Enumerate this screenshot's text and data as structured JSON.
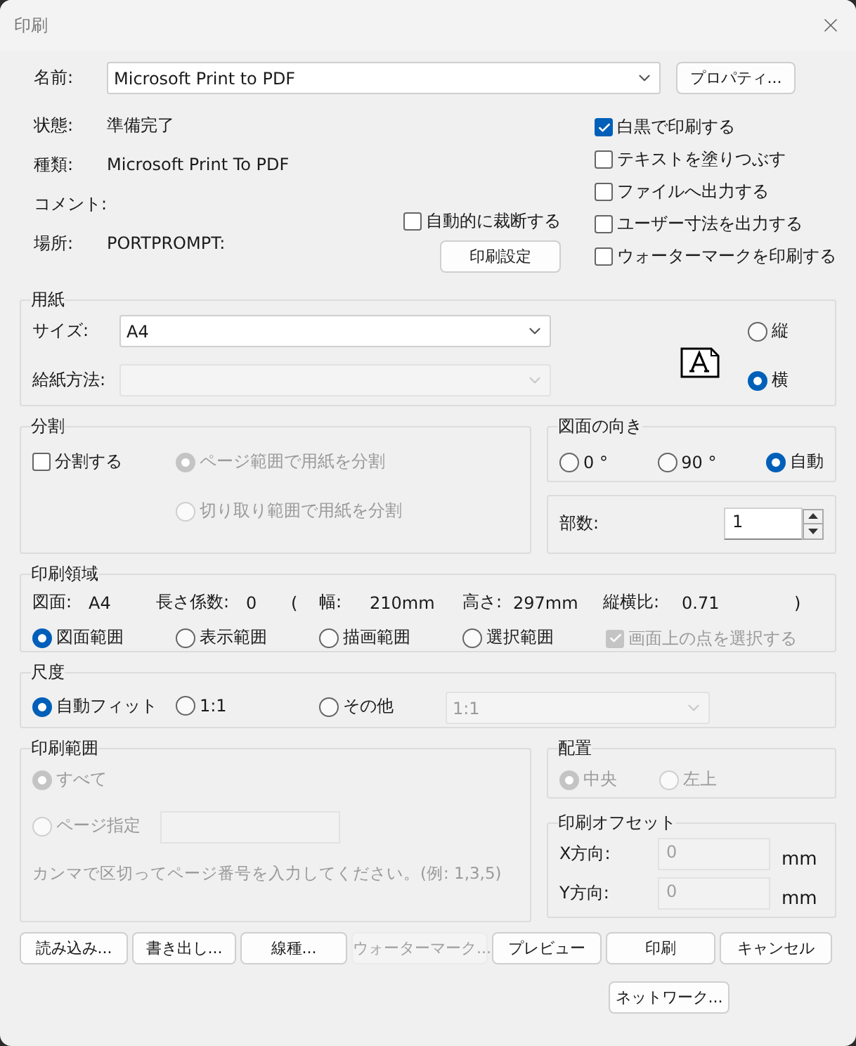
{
  "window": {
    "title": "印刷"
  },
  "printer": {
    "name_label": "名前:",
    "name": "Microsoft Print to PDF",
    "properties_button": "プロパティ...",
    "fields": [
      {
        "label": "状態:",
        "value": "準備完了"
      },
      {
        "label": "種類:",
        "value": "Microsoft Print To PDF"
      },
      {
        "label": "コメント:"
      },
      {
        "label": "場所:",
        "value": "PORTPROMPT:"
      }
    ],
    "auto_cut": {
      "label": "自動的に裁断する",
      "checked": false
    },
    "print_settings_button": "印刷設定",
    "options": [
      {
        "label": "白黒で印刷する",
        "checked": true
      },
      {
        "label": "テキストを塗りつぶす",
        "checked": false
      },
      {
        "label": "ファイルへ出力する",
        "checked": false
      },
      {
        "label": "ユーザー寸法を出力する",
        "checked": false
      },
      {
        "label": "ウォーターマークを印刷する",
        "checked": false
      }
    ]
  },
  "paper": {
    "title": "用紙",
    "size_label": "サイズ:",
    "size": "A4",
    "source_label": "給紙方法:",
    "source_disabled": true,
    "orientations": [
      {
        "label": "縦",
        "selected": false
      },
      {
        "label": "横",
        "selected": true
      }
    ]
  },
  "split": {
    "title": "分割",
    "enable": {
      "label": "分割する",
      "checked": false
    },
    "modes": [
      {
        "label": "ページ範囲で用紙を分割",
        "selected": true,
        "disabled": true
      },
      {
        "label": "切り取り範囲で用紙を分割",
        "selected": false,
        "disabled": true
      }
    ]
  },
  "rotation": {
    "title": "図面の向き",
    "options": [
      {
        "label": "0 °",
        "selected": false
      },
      {
        "label": "90 °",
        "selected": false
      },
      {
        "label": "自動",
        "selected": true
      }
    ]
  },
  "copies": {
    "label": "部数:",
    "value": "1"
  },
  "print_area": {
    "title": "印刷領域",
    "info": [
      {
        "label": "図面:",
        "value": "A4"
      },
      {
        "label": "長さ係数:",
        "value": "0"
      },
      {
        "label": "幅:",
        "value": "210mm"
      },
      {
        "label": "高さ:",
        "value": "297mm"
      },
      {
        "label": "縦横比:",
        "value": "0.71"
      }
    ],
    "open_paren": "(",
    "close_paren": ")",
    "options": [
      {
        "label": "図面範囲",
        "selected": true
      },
      {
        "label": "表示範囲",
        "selected": false
      },
      {
        "label": "描画範囲",
        "selected": false
      },
      {
        "label": "選択範囲",
        "selected": false
      }
    ],
    "pick_points": {
      "label": "画面上の点を選択する",
      "checked": true,
      "disabled": true
    }
  },
  "scale": {
    "title": "尺度",
    "options": [
      {
        "label": "自動フィット",
        "selected": true
      },
      {
        "label": "1:1",
        "selected": false
      },
      {
        "label": "その他",
        "selected": false
      }
    ],
    "custom": {
      "value": "1:1",
      "disabled": true
    }
  },
  "print_range": {
    "title": "印刷範囲",
    "options": [
      {
        "label": "すべて",
        "selected": true,
        "disabled": true
      },
      {
        "label": "ページ指定",
        "selected": false,
        "disabled": true
      }
    ],
    "pages_disabled": true,
    "hint": "カンマで区切ってページ番号を入力してください。(例: 1,3,5)"
  },
  "placement": {
    "title": "配置",
    "options": [
      {
        "label": "中央",
        "selected": true,
        "disabled": true
      },
      {
        "label": "左上",
        "selected": false,
        "disabled": true
      }
    ]
  },
  "offset": {
    "title": "印刷オフセット",
    "disabled": true,
    "fields": [
      {
        "label": "X方向:",
        "value": "0",
        "unit": "mm"
      },
      {
        "label": "Y方向:",
        "value": "0",
        "unit": "mm"
      }
    ]
  },
  "buttons": [
    {
      "label": "読み込み...",
      "disabled": false
    },
    {
      "label": "書き出し...",
      "disabled": false
    },
    {
      "label": "線種...",
      "disabled": false
    },
    {
      "label": "ウォーターマーク...",
      "disabled": true
    },
    {
      "label": "プレビュー",
      "disabled": false
    },
    {
      "label": "印刷",
      "disabled": false
    },
    {
      "label": "キャンセル",
      "disabled": false
    }
  ],
  "network_button": "ネットワーク..."
}
